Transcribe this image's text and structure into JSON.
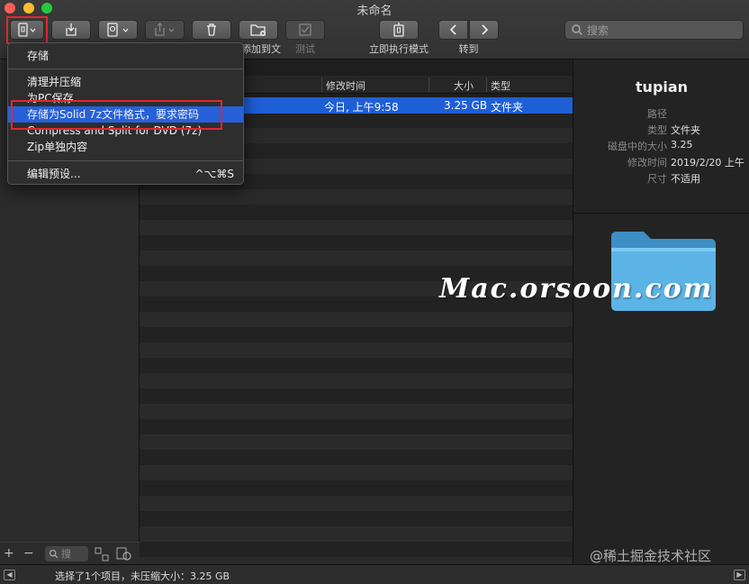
{
  "window": {
    "title": "未命名"
  },
  "toolbar": {
    "labels": [
      "添加到文件夹",
      "测试",
      "立即执行模式",
      "转到"
    ],
    "search_placeholder": "搜索"
  },
  "menu": {
    "items": [
      "存储",
      "清理并压缩",
      "为PC保存",
      "存储为Solid 7z文件格式，要求密码",
      "Compress and Split for DVD (7z)",
      "Zip单独内容",
      "编辑预设..."
    ],
    "shortcut": "^⌥⌘S"
  },
  "list": {
    "columns": [
      "修改时间",
      "大小",
      "类型"
    ],
    "rows": [
      {
        "modified": "今日, 上午9:58",
        "size": "3.25 GB",
        "kind": "文件夹"
      }
    ]
  },
  "info": {
    "title": "tupian",
    "keys": [
      "路径",
      "类型",
      "磁盘中的大小",
      "修改时间",
      "尺寸"
    ],
    "values": [
      "",
      "文件夹",
      "3.25",
      "2019/2/20 上午",
      "不适用"
    ]
  },
  "sidebar": {
    "mini_search": "搜"
  },
  "status": {
    "text": "选择了1个项目，未压缩大小：3.25 GB"
  },
  "watermarks": {
    "main": "Mac.orsoon.com",
    "corner": "@稀土掘金技术社区"
  },
  "colors": {
    "selection": "#1f5fd6",
    "highlight_box": "#e0282e",
    "folder": "#4aa3d8"
  }
}
